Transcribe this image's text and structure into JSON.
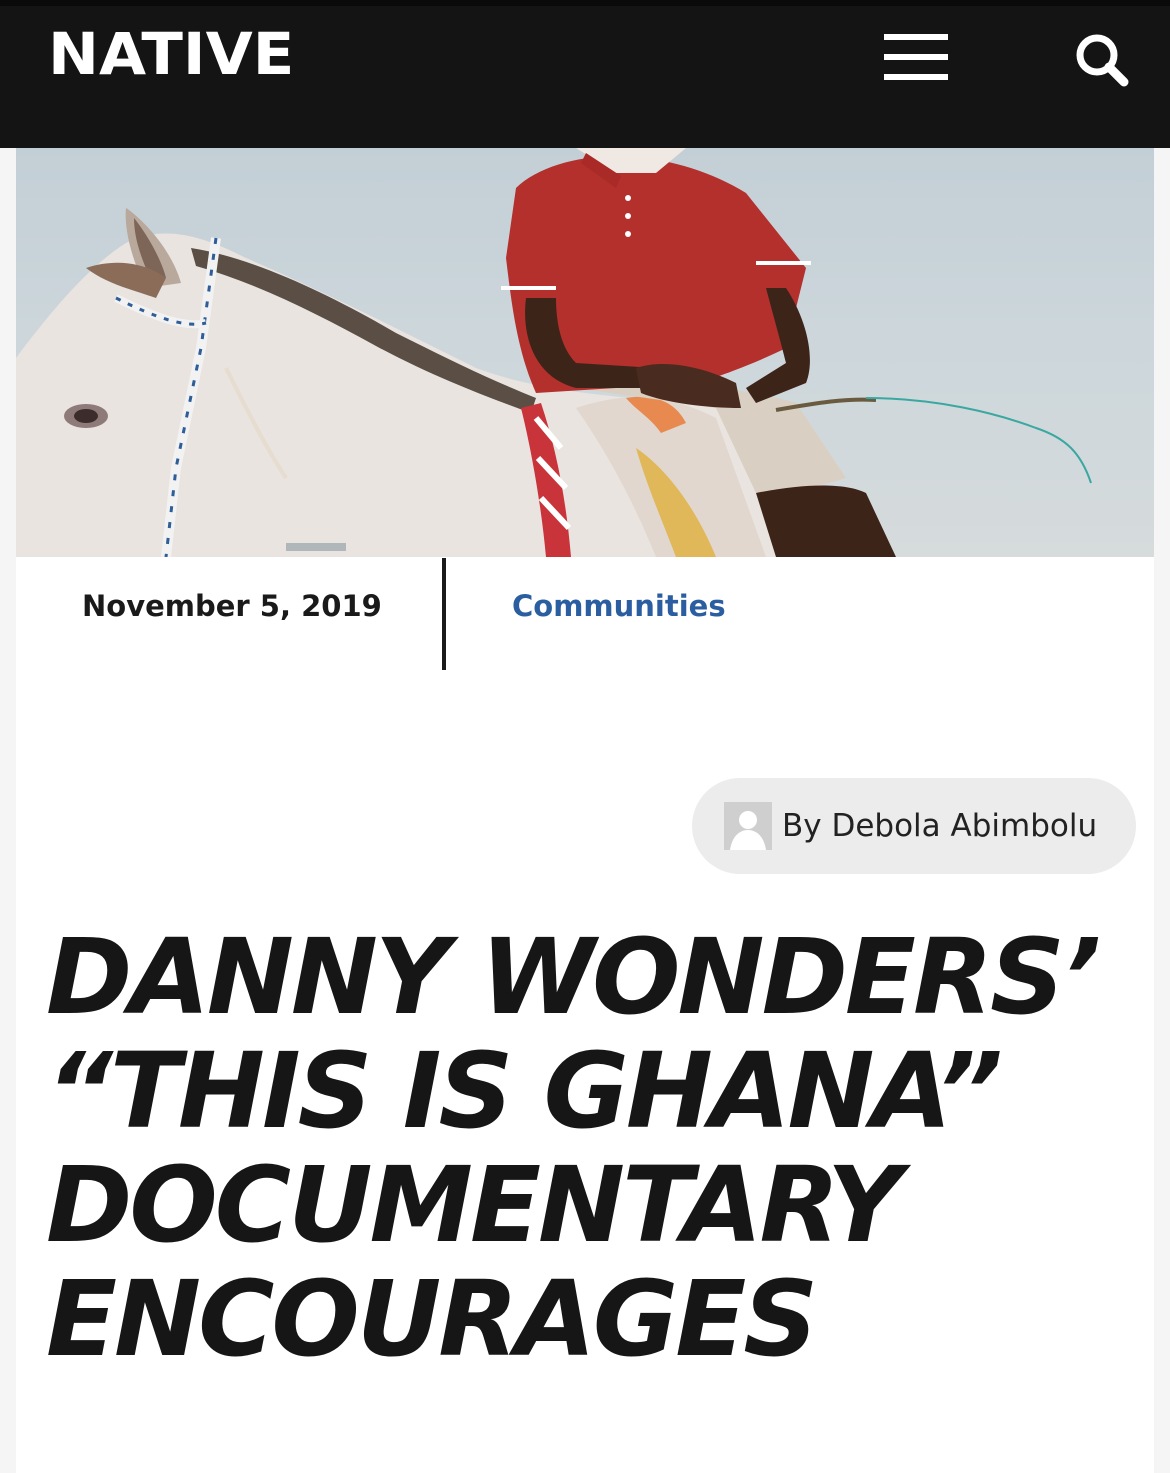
{
  "header": {
    "logo": "NATIVE",
    "menu_icon": "hamburger-menu-icon",
    "search_icon": "search-icon",
    "background": "#141414"
  },
  "hero": {
    "description_icon": "horse-rider-photo"
  },
  "meta": {
    "date": "November 5, 2019",
    "category": "Communities",
    "category_color": "#2a5ea0"
  },
  "byline": {
    "text": "By Debola Abimbolu",
    "avatar_icon": "avatar-placeholder-icon"
  },
  "article": {
    "headline": "DANNY WONDERS’ “THIS IS GHANA” DOCUMENTARY ENCOURAGES"
  }
}
